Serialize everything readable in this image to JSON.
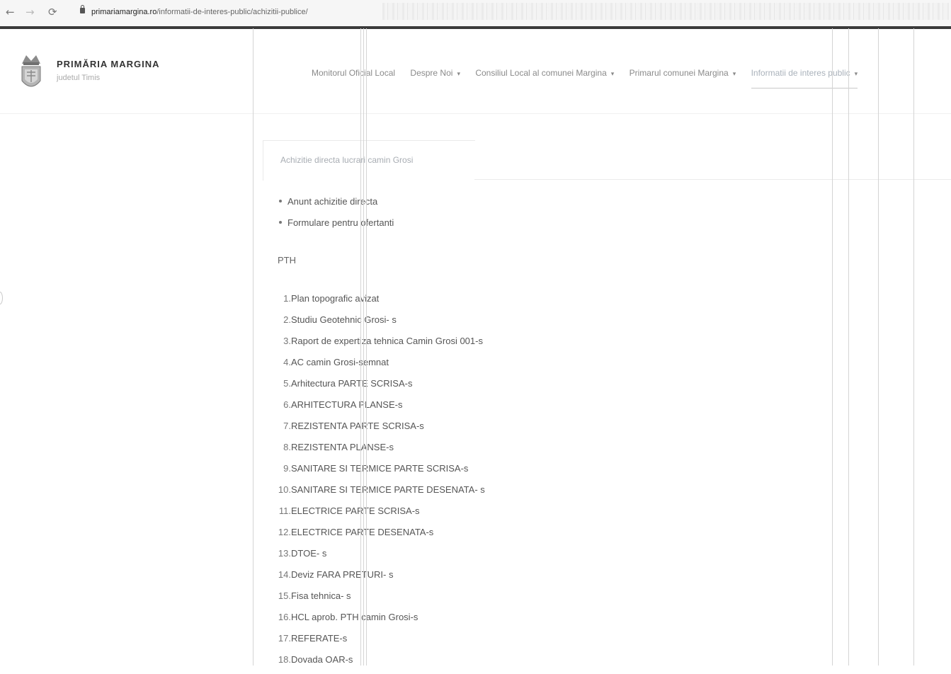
{
  "browser": {
    "url_host": "primariamargina.ro",
    "url_path": "/informatii-de-interes-public/achizitii-publice/"
  },
  "site": {
    "title": "PRIMĂRIA MARGINA",
    "subtitle": "judetul Timis"
  },
  "nav": [
    {
      "label": "Monitorul Oficial Local",
      "has_dropdown": false
    },
    {
      "label": "Despre Noi",
      "has_dropdown": true
    },
    {
      "label": "Consiliul Local al comunei Margina",
      "has_dropdown": true
    },
    {
      "label": "Primarul comunei Margina",
      "has_dropdown": true
    },
    {
      "label": "Informatii de interes public",
      "has_dropdown": true,
      "active": true
    }
  ],
  "content": {
    "tab_title": "Achizitie directa lucrari camin Grosi",
    "bullets": [
      "Anunt achizitie directa",
      "Formulare pentru ofertanti"
    ],
    "section_label": "PTH",
    "documents": [
      "Plan topografic avizat",
      "Studiu Geotehnic Grosi- s",
      "Raport de expertiza tehnica Camin Grosi 001-s",
      "AC camin Grosi-semnat",
      "Arhitectura PARTE SCRISA-s",
      "ARHITECTURA PLANSE-s",
      "REZISTENTA PARTE SCRISA-s",
      "REZISTENTA PLANSE-s",
      "SANITARE SI TERMICE PARTE SCRISA-s",
      "SANITARE SI TERMICE PARTE DESENATA- s",
      "ELECTRICE PARTE SCRISA-s",
      "ELECTRICE PARTE DESENATA-s",
      "DTOE- s",
      "Deviz FARA PRETURI- s",
      "Fisa tehnica- s",
      "HCL aprob. PTH camin Grosi-s",
      "REFERATE-s",
      "Dovada OAR-s"
    ]
  },
  "colors": {
    "chrome_bg": "#f6f6f6",
    "nav_text": "#8a8a8a",
    "body_text": "#555555"
  }
}
